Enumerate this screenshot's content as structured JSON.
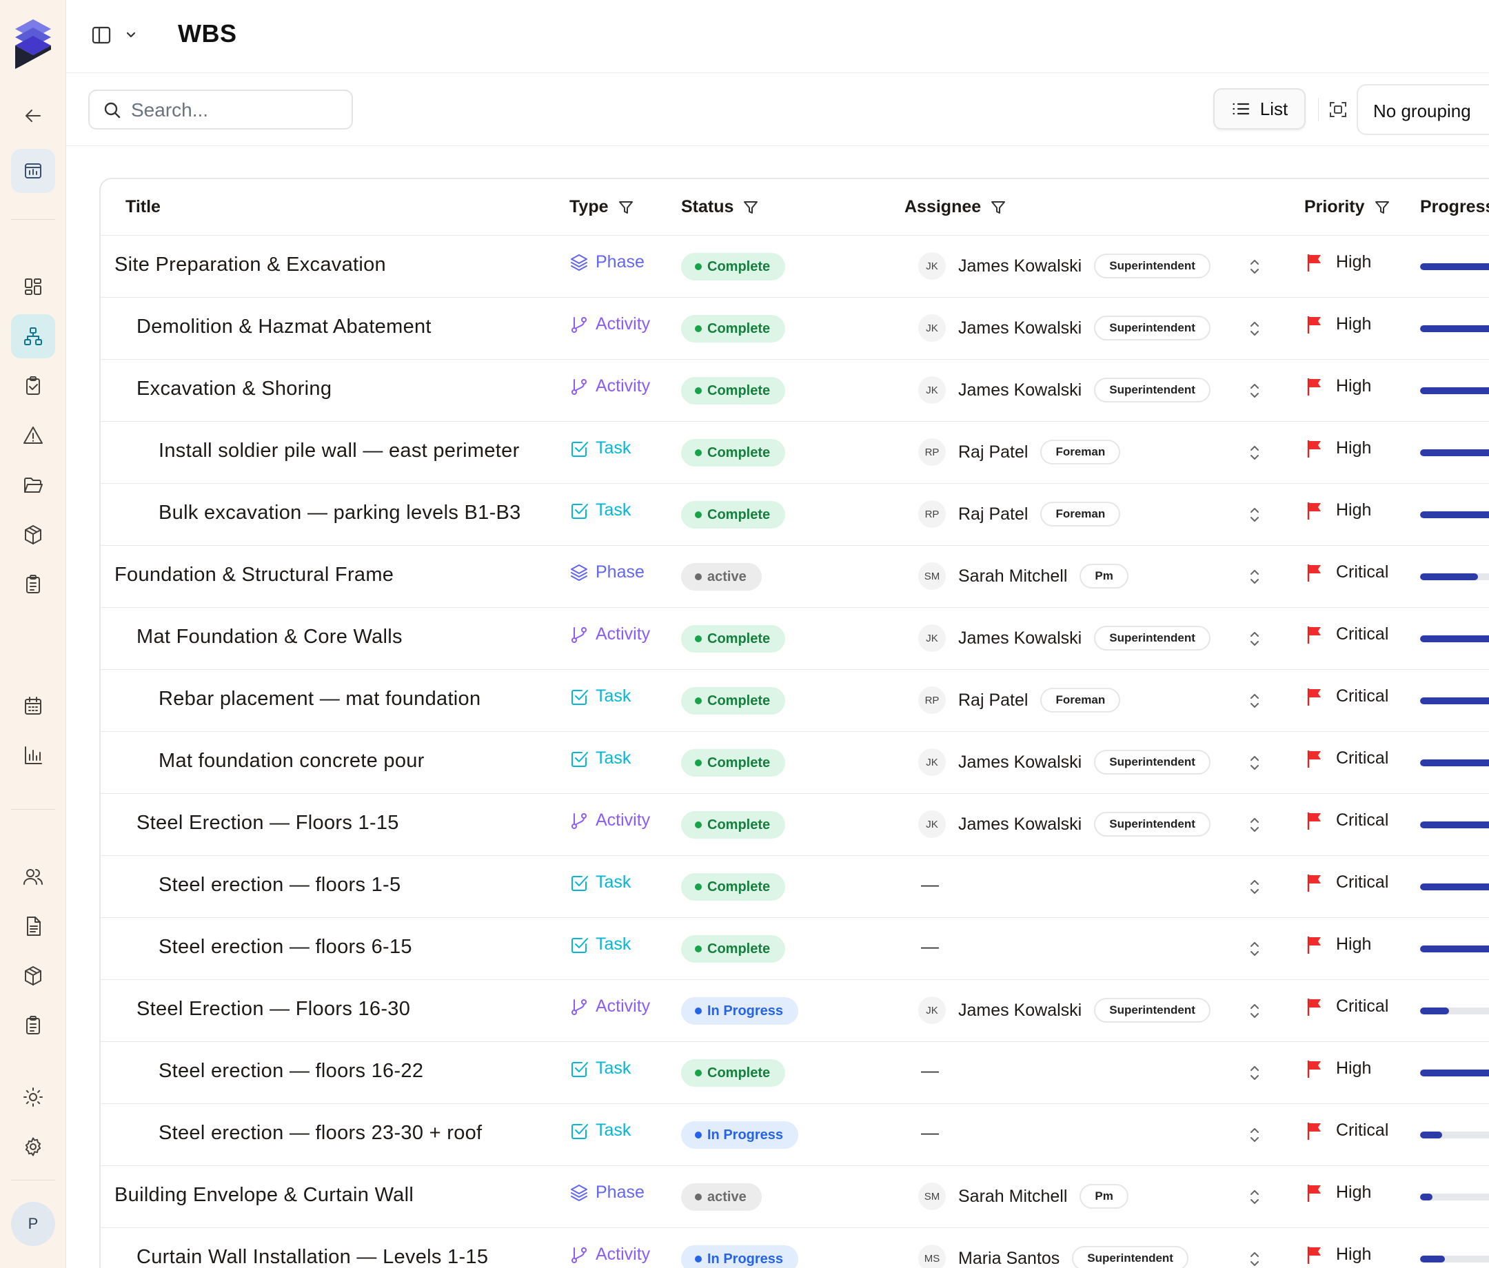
{
  "header": {
    "title": "WBS"
  },
  "toolbar": {
    "search_placeholder": "Search...",
    "view_label": "List",
    "grouping_label": "No grouping"
  },
  "rail": {
    "avatar_initial": "P",
    "icons": [
      "layers-logo-icon",
      "back-arrow-icon",
      "project-board-icon",
      "dashboard-grid-icon",
      "hierarchy-icon",
      "clipboard-check-icon",
      "warning-icon",
      "folder-open-icon",
      "package-icon",
      "clipboard-list-icon",
      "calendar-icon",
      "bar-chart-icon",
      "users-icon",
      "document-icon",
      "package-icon",
      "clipboard-list-icon",
      "sun-icon",
      "gear-icon"
    ]
  },
  "table": {
    "columns": {
      "title": "Title",
      "type": "Type",
      "status": "Status",
      "assignee": "Assignee",
      "priority": "Priority",
      "progress": "Progress"
    },
    "rows": [
      {
        "title": "Site Preparation & Excavation",
        "level": 0,
        "type": "Phase",
        "status": "Complete",
        "initials": "JK",
        "assignee": "James Kowalski",
        "role": "Superintendent",
        "priority": "High",
        "progress": 1.0
      },
      {
        "title": "Demolition & Hazmat Abatement",
        "level": 1,
        "type": "Activity",
        "status": "Complete",
        "initials": "JK",
        "assignee": "James Kowalski",
        "role": "Superintendent",
        "priority": "High",
        "progress": 1.0
      },
      {
        "title": "Excavation & Shoring",
        "level": 1,
        "type": "Activity",
        "status": "Complete",
        "initials": "JK",
        "assignee": "James Kowalski",
        "role": "Superintendent",
        "priority": "High",
        "progress": 1.0
      },
      {
        "title": "Install soldier pile wall — east perimeter",
        "level": 2,
        "type": "Task",
        "status": "Complete",
        "initials": "RP",
        "assignee": "Raj Patel",
        "role": "Foreman",
        "priority": "High",
        "progress": 1.0
      },
      {
        "title": "Bulk excavation — parking levels B1-B3",
        "level": 2,
        "type": "Task",
        "status": "Complete",
        "initials": "RP",
        "assignee": "Raj Patel",
        "role": "Foreman",
        "priority": "High",
        "progress": 1.0
      },
      {
        "title": "Foundation & Structural Frame",
        "level": 0,
        "type": "Phase",
        "status": "active",
        "initials": "SM",
        "assignee": "Sarah Mitchell",
        "role": "Pm",
        "priority": "Critical",
        "progress": 0.6
      },
      {
        "title": "Mat Foundation & Core Walls",
        "level": 1,
        "type": "Activity",
        "status": "Complete",
        "initials": "JK",
        "assignee": "James Kowalski",
        "role": "Superintendent",
        "priority": "Critical",
        "progress": 1.0
      },
      {
        "title": "Rebar placement — mat foundation",
        "level": 2,
        "type": "Task",
        "status": "Complete",
        "initials": "RP",
        "assignee": "Raj Patel",
        "role": "Foreman",
        "priority": "Critical",
        "progress": 1.0
      },
      {
        "title": "Mat foundation concrete pour",
        "level": 2,
        "type": "Task",
        "status": "Complete",
        "initials": "JK",
        "assignee": "James Kowalski",
        "role": "Superintendent",
        "priority": "Critical",
        "progress": 1.0
      },
      {
        "title": "Steel Erection — Floors 1-15",
        "level": 1,
        "type": "Activity",
        "status": "Complete",
        "initials": "JK",
        "assignee": "James Kowalski",
        "role": "Superintendent",
        "priority": "Critical",
        "progress": 1.0
      },
      {
        "title": "Steel erection — floors 1-5",
        "level": 2,
        "type": "Task",
        "status": "Complete",
        "initials": "",
        "assignee": "",
        "role": "",
        "priority": "Critical",
        "progress": 1.0
      },
      {
        "title": "Steel erection — floors 6-15",
        "level": 2,
        "type": "Task",
        "status": "Complete",
        "initials": "",
        "assignee": "",
        "role": "",
        "priority": "High",
        "progress": 1.0
      },
      {
        "title": "Steel Erection — Floors 16-30",
        "level": 1,
        "type": "Activity",
        "status": "In Progress",
        "initials": "JK",
        "assignee": "James Kowalski",
        "role": "Superintendent",
        "priority": "Critical",
        "progress": 0.3
      },
      {
        "title": "Steel erection — floors 16-22",
        "level": 2,
        "type": "Task",
        "status": "Complete",
        "initials": "",
        "assignee": "",
        "role": "",
        "priority": "High",
        "progress": 1.0
      },
      {
        "title": "Steel erection — floors 23-30 + roof",
        "level": 2,
        "type": "Task",
        "status": "In Progress",
        "initials": "",
        "assignee": "",
        "role": "",
        "priority": "Critical",
        "progress": 0.23
      },
      {
        "title": "Building Envelope & Curtain Wall",
        "level": 0,
        "type": "Phase",
        "status": "active",
        "initials": "SM",
        "assignee": "Sarah Mitchell",
        "role": "Pm",
        "priority": "High",
        "progress": 0.13
      },
      {
        "title": "Curtain Wall Installation — Levels 1-15",
        "level": 1,
        "type": "Activity",
        "status": "In Progress",
        "initials": "MS",
        "assignee": "Maria Santos",
        "role": "Superintendent",
        "priority": "High",
        "progress": 0.26
      }
    ],
    "empty_assignee": "—"
  },
  "colors": {
    "accent": "#0e7490",
    "phase": "#6366f1",
    "activity": "#8b5cf6",
    "task": "#06b6d4",
    "flag": "#dc2626",
    "progress_fill": "#2d3ba8"
  }
}
